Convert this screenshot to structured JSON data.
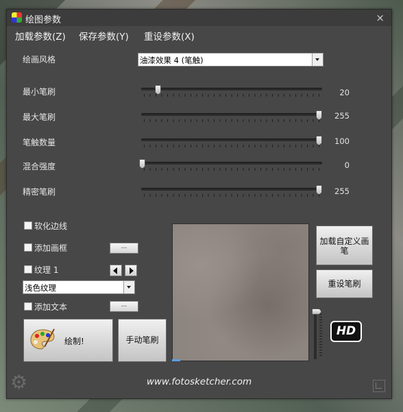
{
  "window": {
    "title": "绘图参数",
    "close": "×"
  },
  "menu": {
    "load": "加载参数(Z)",
    "save": "保存参数(Y)",
    "reset": "重设参数(X)"
  },
  "style": {
    "label": "绘画风格",
    "value": "油漆效果 4 (笔触)"
  },
  "sliders": [
    {
      "label": "最小笔刷",
      "value": "20",
      "level": 0.09
    },
    {
      "label": "最大笔刷",
      "value": "255",
      "level": 1.0
    },
    {
      "label": "笔触数量",
      "value": "100",
      "level": 1.0
    },
    {
      "label": "混合强度",
      "value": "0",
      "level": 0.0
    },
    {
      "label": "精密笔刷",
      "value": "255",
      "level": 1.0
    }
  ],
  "options": {
    "soften_edges": "软化边线",
    "add_frame": "添加画框",
    "texture": "纹理 1",
    "texture_select": "浅色纹理",
    "add_text": "添加文本",
    "ellipsis": "..."
  },
  "buttons": {
    "draw": "绘制!",
    "manual": "手动笔刷",
    "load_custom": "加载自定义画笔",
    "reset_brush": "重设笔刷"
  },
  "hd": "HD",
  "footer": "www.fotosketcher.com",
  "icons": [
    "app-icon",
    "close-icon",
    "dropdown-arrow-icon",
    "palette-icon",
    "arrow-left-icon",
    "arrow-right-icon",
    "gear-icon",
    "resize-icon"
  ]
}
